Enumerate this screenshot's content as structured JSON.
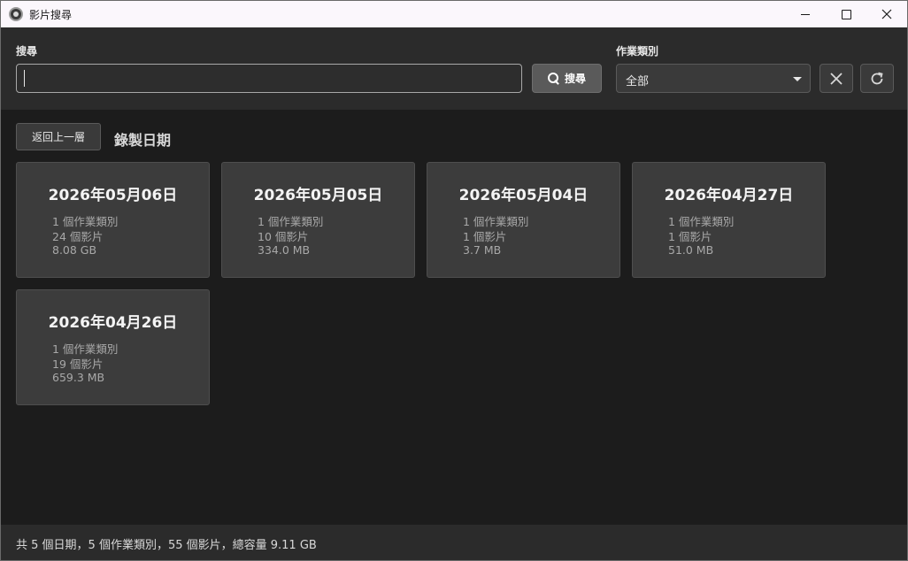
{
  "window": {
    "title": "影片搜尋",
    "colors": {
      "titlebar": "#fbf7fc",
      "background": "#1c1c1c",
      "panel": "#2b2b2b",
      "card": "#3c3c3c"
    }
  },
  "search": {
    "label": "搜尋",
    "value": "",
    "placeholder": "",
    "button_label": "搜尋",
    "button_icon": "search-icon"
  },
  "category": {
    "label": "作業類別",
    "selected": "全部"
  },
  "toolbar": {
    "clear_icon": "close-icon",
    "refresh_icon": "refresh-icon"
  },
  "nav": {
    "back_label": "返回上一層",
    "section_title": "錄製日期"
  },
  "cards": [
    {
      "date": "2026年05月06日",
      "categories": "1 個作業類別",
      "videos": "24 個影片",
      "size": "8.08 GB"
    },
    {
      "date": "2026年05月05日",
      "categories": "1 個作業類別",
      "videos": "10 個影片",
      "size": "334.0 MB"
    },
    {
      "date": "2026年05月04日",
      "categories": "1 個作業類別",
      "videos": "1 個影片",
      "size": "3.7 MB"
    },
    {
      "date": "2026年04月27日",
      "categories": "1 個作業類別",
      "videos": "1 個影片",
      "size": "51.0 MB"
    },
    {
      "date": "2026年04月26日",
      "categories": "1 個作業類別",
      "videos": "19 個影片",
      "size": "659.3 MB"
    }
  ],
  "status": {
    "summary": "共 5 個日期，5 個作業類別，55 個影片，總容量 9.11 GB"
  }
}
